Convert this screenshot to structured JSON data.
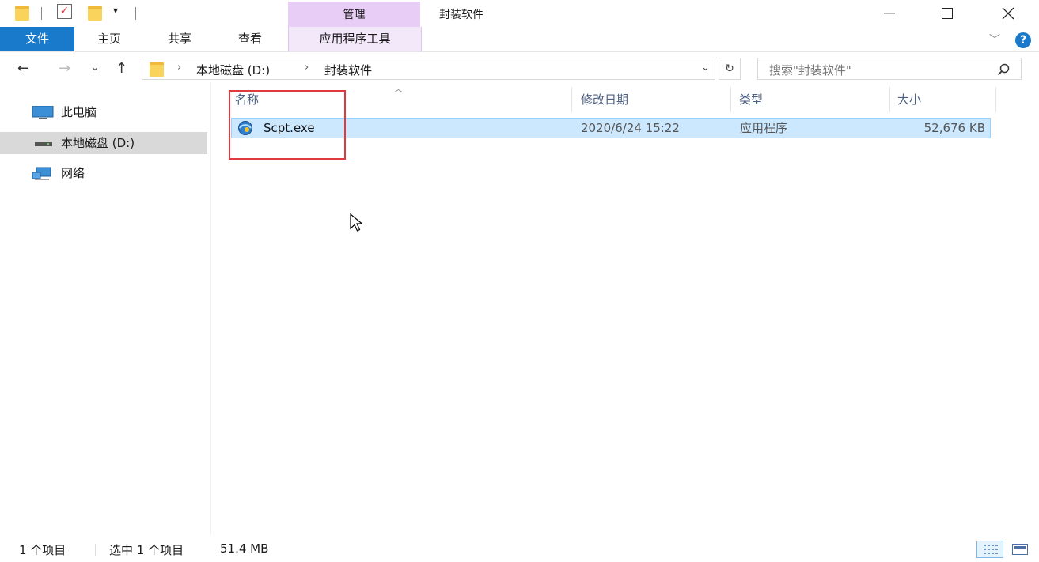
{
  "window": {
    "title": "封装软件",
    "contextual_group": "管理"
  },
  "ribbon": {
    "tabs": [
      {
        "label": "文件",
        "active": true
      },
      {
        "label": "主页"
      },
      {
        "label": "共享"
      },
      {
        "label": "查看"
      },
      {
        "label": "应用程序工具"
      }
    ]
  },
  "address": {
    "path": [
      "本地磁盘 (D:)",
      "封装软件"
    ],
    "search_placeholder": "搜索\"封装软件\""
  },
  "navpane": {
    "items": [
      {
        "label": "此电脑",
        "icon": "computer-icon"
      },
      {
        "label": "本地磁盘 (D:)",
        "icon": "drive-icon",
        "selected": true
      },
      {
        "label": "网络",
        "icon": "network-icon"
      }
    ]
  },
  "list": {
    "columns": [
      "名称",
      "修改日期",
      "类型",
      "大小"
    ],
    "rows": [
      {
        "name": "Scpt.exe",
        "modified": "2020/6/24 15:22",
        "type": "应用程序",
        "size": "52,676 KB",
        "selected": true
      }
    ]
  },
  "status": {
    "count": "1 个项目",
    "selection": "选中 1 个项目",
    "size": "51.4 MB"
  },
  "colors": {
    "accent": "#1979ca",
    "selection_bg": "#cce8ff",
    "contextual_tab": "#e8cdf6",
    "highlight_box": "#e0393e"
  }
}
